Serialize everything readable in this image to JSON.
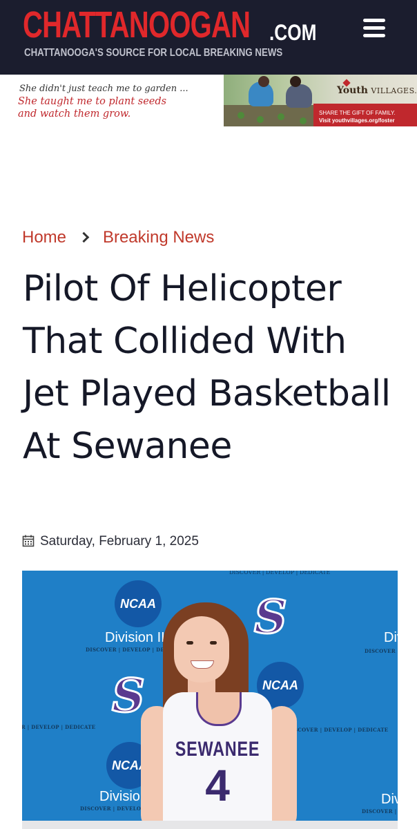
{
  "header": {
    "logo_main": "CHATTANOOGAN",
    "logo_tld": ".COM",
    "tagline": "CHATTANOOGA'S SOURCE FOR LOCAL BREAKING NEWS",
    "menu_icon": "hamburger-menu-icon",
    "background_color": "#1b1d2e",
    "logo_color": "#e0282b"
  },
  "ad": {
    "line1": "She didn't just teach me to garden ...",
    "line2": "She taught me to plant seeds",
    "line3": "and watch them grow.",
    "brand_youth": "Youth",
    "brand_villages": "VILLAGES.",
    "cta_line1": "SHARE THE GIFT OF FAMILY.",
    "cta_line2": "Visit youthvillages.org/foster",
    "accent_color": "#c0282d"
  },
  "breadcrumb": {
    "home": "Home",
    "section": "Breaking News",
    "link_color": "#c0392b"
  },
  "article": {
    "title": "Pilot Of Helicopter That Collided With Jet Played Basketball At Sewanee",
    "date": "Saturday, February 1, 2025",
    "date_icon": "calendar-icon"
  },
  "image": {
    "ncaa": "NCAA",
    "division": "Division III",
    "tagline": "DISCOVER | DEVELOP | DEDICATE",
    "jersey_name": "SEWANEE",
    "jersey_number": "4",
    "s_logo": "S"
  }
}
